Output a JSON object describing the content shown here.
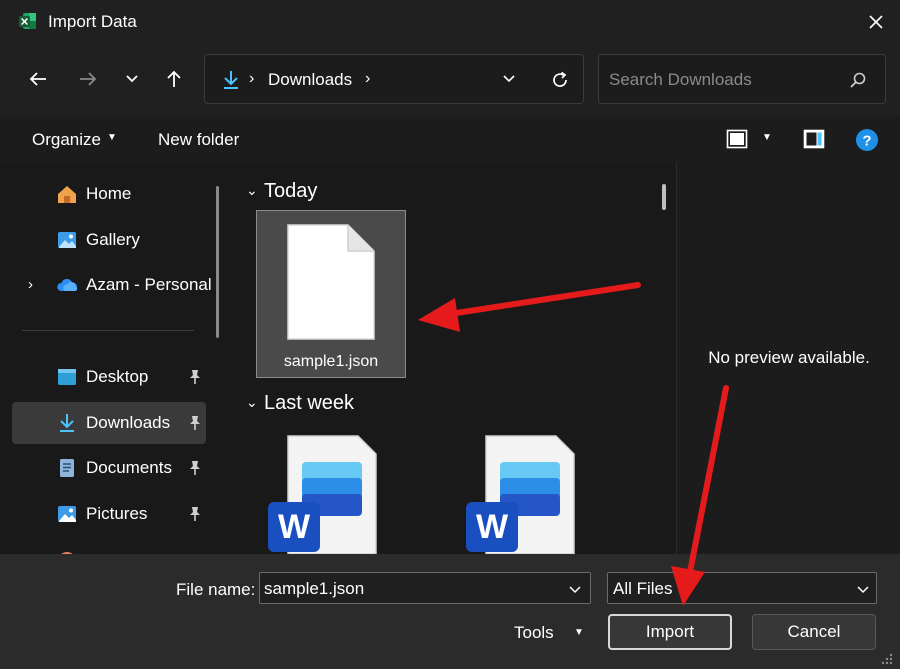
{
  "window": {
    "title": "Import Data",
    "app_icon": "excel-icon",
    "close_icon": "close-icon"
  },
  "nav": {
    "back_icon": "arrow-left-icon",
    "forward_icon": "arrow-right-icon",
    "recent_icon": "chevron-down-icon",
    "up_icon": "arrow-up-icon",
    "address": {
      "location_icon": "download-icon",
      "separator": "›",
      "path": "Downloads",
      "trailing_separator": "›"
    },
    "refresh_icon": "refresh-icon",
    "search": {
      "placeholder": "Search Downloads",
      "icon": "search-icon"
    }
  },
  "commands": {
    "organize": "Organize",
    "organize_chevron": "▼",
    "new_folder": "New folder",
    "view_icon": "view-mode-icon",
    "view_chevron": "▼",
    "preview_pane_icon": "preview-pane-icon",
    "help_label": "?"
  },
  "sidebar": {
    "items": [
      {
        "label": "Home",
        "icon": "home-icon",
        "pinned": false,
        "expandable": false,
        "selected": false
      },
      {
        "label": "Gallery",
        "icon": "gallery-icon",
        "pinned": false,
        "expandable": false,
        "selected": false
      },
      {
        "label": "Azam - Personal",
        "icon": "onedrive-icon",
        "pinned": false,
        "expandable": true,
        "selected": false
      },
      {
        "label": "Desktop",
        "icon": "desktop-icon",
        "pinned": true,
        "expandable": false,
        "selected": false
      },
      {
        "label": "Downloads",
        "icon": "download-icon",
        "pinned": true,
        "expandable": false,
        "selected": true
      },
      {
        "label": "Documents",
        "icon": "documents-icon",
        "pinned": true,
        "expandable": false,
        "selected": false
      },
      {
        "label": "Pictures",
        "icon": "pictures-icon",
        "pinned": true,
        "expandable": false,
        "selected": false
      }
    ],
    "expand_glyph": "›",
    "pin_icon": "pin-icon"
  },
  "content": {
    "groups": [
      {
        "label": "Today",
        "chevron": "⌄",
        "files": [
          {
            "name": "sample1.json",
            "icon": "generic-file-icon",
            "selected": true
          }
        ]
      },
      {
        "label": "Last week",
        "chevron": "⌄",
        "files": [
          {
            "name": "",
            "icon": "word-document-icon",
            "selected": false
          },
          {
            "name": "",
            "icon": "word-document-icon",
            "selected": false
          }
        ]
      }
    ],
    "word_badge_letter": "W"
  },
  "preview": {
    "text": "No preview available."
  },
  "footer": {
    "file_name_label": "File name:",
    "file_name_value": "sample1.json",
    "file_type_value": "All Files",
    "tools_label": "Tools",
    "tools_chevron": "▼",
    "import_label": "Import",
    "cancel_label": "Cancel"
  },
  "colors": {
    "accent": "#4cc2ff",
    "selection": "#3a3a3a",
    "annotation_arrow": "#e51b1b",
    "help_blue": "#1e90e6"
  },
  "annotations": {
    "arrows": [
      "arrow-to-sample1-json",
      "arrow-to-import-button"
    ]
  }
}
